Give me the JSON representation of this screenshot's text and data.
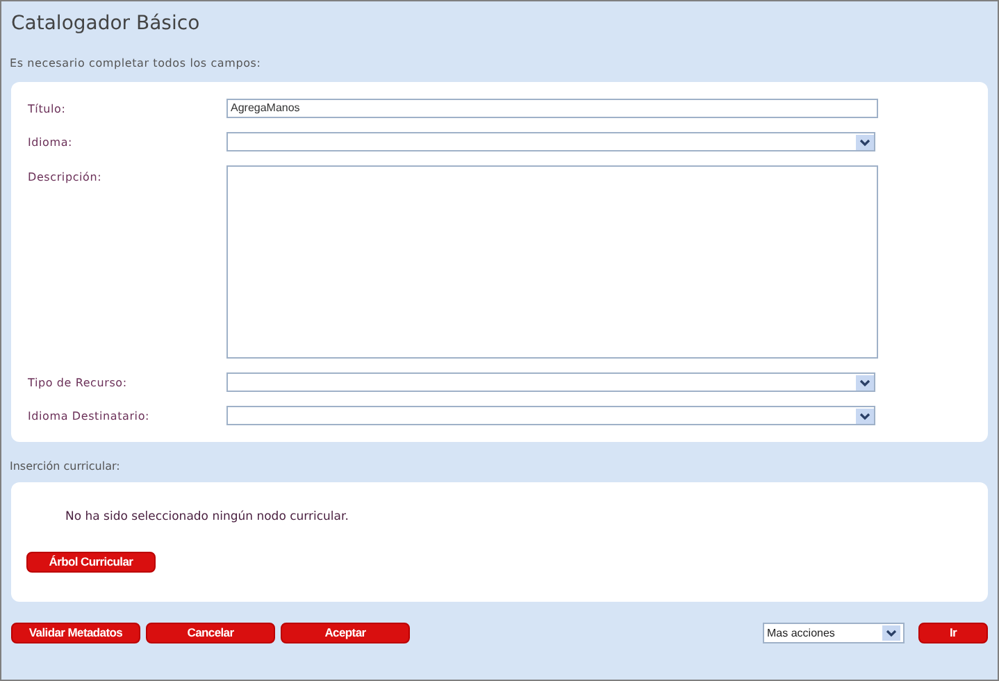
{
  "header": {
    "title": "Catalogador Básico",
    "subtitle": "Es necesario completar todos los campos:"
  },
  "fields": [
    {
      "kind": "text",
      "label": "Título:",
      "value": "AgregaManos"
    },
    {
      "kind": "select",
      "label": "Idioma:"
    },
    {
      "kind": "textarea",
      "label": "Descripción:"
    },
    {
      "kind": "select",
      "label": "Tipo de Recurso:"
    },
    {
      "kind": "select",
      "label": "Idioma Destinatario:"
    }
  ],
  "curricular": {
    "heading": "Inserción curricular:",
    "message": "No ha sido seleccionado ningún nodo curricular.",
    "button": "Árbol Curricular"
  },
  "footer": {
    "buttons": [
      "Validar Metadatos",
      "Cancelar",
      "Aceptar"
    ],
    "actions": {
      "value": "Mas acciones"
    },
    "go_button": "Ir"
  }
}
